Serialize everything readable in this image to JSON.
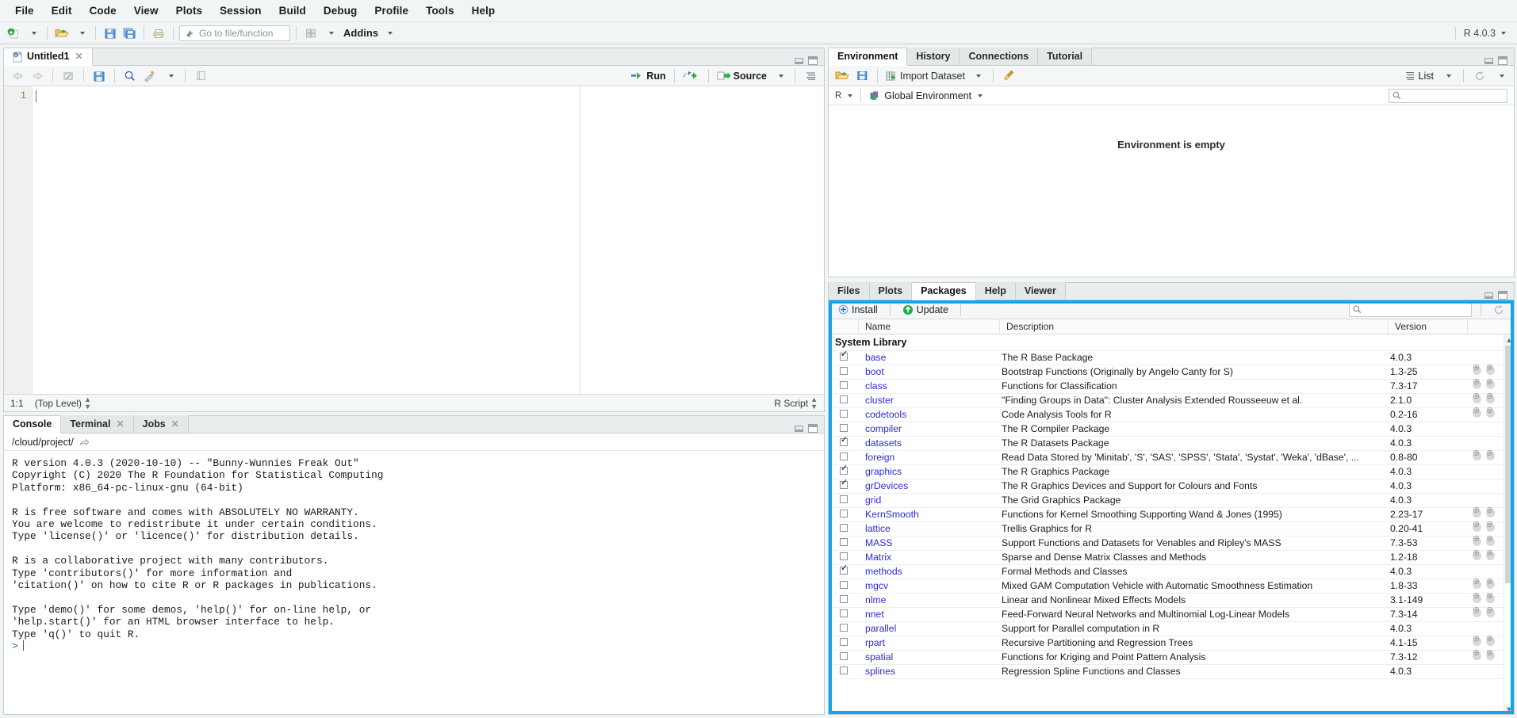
{
  "menubar": {
    "items": [
      "File",
      "Edit",
      "Code",
      "View",
      "Plots",
      "Session",
      "Build",
      "Debug",
      "Profile",
      "Tools",
      "Help"
    ]
  },
  "toolbar": {
    "new_file_icon": "new-file-icon",
    "open_file_icon": "open-folder-icon",
    "save_icon": "save-icon",
    "save_all_icon": "save-all-icon",
    "print_icon": "print-icon",
    "goto_placeholder": "Go to file/function",
    "goto_icon": "arrow-icon",
    "panes_icon": "workspace-panes-icon",
    "addins_label": "Addins",
    "r_version": "R 4.0.3"
  },
  "source": {
    "tab_label": "Untitled1",
    "tab_icon": "r-script-icon",
    "toolbar_icons": [
      "back-arrow-icon",
      "forward-arrow-icon",
      "show-in-new-window-icon",
      "save-icon",
      "find-replace-icon",
      "code-tools-icon",
      "compile-report-icon"
    ],
    "run_label": "Run",
    "source_label": "Source",
    "rerun_icon": "rerun-icon",
    "outline_icon": "document-outline-icon",
    "line_numbers": [
      "1"
    ],
    "code_lines": [
      ""
    ],
    "status_position": "1:1",
    "status_scope": "(Top Level)",
    "status_type": "R Script"
  },
  "console": {
    "tabs": [
      {
        "label": "Console",
        "closable": false,
        "active": true
      },
      {
        "label": "Terminal",
        "closable": true,
        "active": false
      },
      {
        "label": "Jobs",
        "closable": true,
        "active": false
      }
    ],
    "path": "/cloud/project/",
    "path_icon": "open-in-new-window-icon",
    "output": "R version 4.0.3 (2020-10-10) -- \"Bunny-Wunnies Freak Out\"\nCopyright (C) 2020 The R Foundation for Statistical Computing\nPlatform: x86_64-pc-linux-gnu (64-bit)\n\nR is free software and comes with ABSOLUTELY NO WARRANTY.\nYou are welcome to redistribute it under certain conditions.\nType 'license()' or 'licence()' for distribution details.\n\nR is a collaborative project with many contributors.\nType 'contributors()' for more information and\n'citation()' on how to cite R or R packages in publications.\n\nType 'demo()' for some demos, 'help()' for on-line help, or\n'help.start()' for an HTML browser interface to help.\nType 'q()' to quit R.\n",
    "prompt": ">"
  },
  "environment": {
    "tabs": [
      {
        "label": "Environment",
        "active": true
      },
      {
        "label": "History",
        "active": false
      },
      {
        "label": "Connections",
        "active": false
      },
      {
        "label": "Tutorial",
        "active": false
      }
    ],
    "toolbar": {
      "load_icon": "load-workspace-icon",
      "save_icon": "save-workspace-icon",
      "import_label": "Import Dataset",
      "broom_icon": "clear-objects-icon",
      "list_label": "List",
      "list_icon": "list-view-icon",
      "refresh_icon": "refresh-icon"
    },
    "language_selector": "R",
    "scope_label": "Global Environment",
    "scope_icon": "cube-icon",
    "search_placeholder": "",
    "search_icon": "search-icon",
    "empty_message": "Environment is empty"
  },
  "packages": {
    "tabs": [
      {
        "label": "Files",
        "active": false
      },
      {
        "label": "Plots",
        "active": false
      },
      {
        "label": "Packages",
        "active": true
      },
      {
        "label": "Help",
        "active": false
      },
      {
        "label": "Viewer",
        "active": false
      }
    ],
    "toolbar": {
      "install_label": "Install",
      "install_icon": "install-package-icon",
      "update_label": "Update",
      "update_icon": "update-package-icon",
      "search_placeholder": "",
      "search_icon": "search-icon",
      "refresh_icon": "refresh-icon"
    },
    "columns": [
      "",
      "Name",
      "Description",
      "Version",
      ""
    ],
    "groups": [
      {
        "title": "System Library",
        "rows": [
          {
            "checked": true,
            "name": "base",
            "description": "The R Base Package",
            "version": "4.0.3",
            "actions": false
          },
          {
            "checked": false,
            "name": "boot",
            "description": "Bootstrap Functions (Originally by Angelo Canty for S)",
            "version": "1.3-25",
            "actions": true
          },
          {
            "checked": false,
            "name": "class",
            "description": "Functions for Classification",
            "version": "7.3-17",
            "actions": true
          },
          {
            "checked": false,
            "name": "cluster",
            "description": "\"Finding Groups in Data\": Cluster Analysis Extended Rousseeuw et al.",
            "version": "2.1.0",
            "actions": true
          },
          {
            "checked": false,
            "name": "codetools",
            "description": "Code Analysis Tools for R",
            "version": "0.2-16",
            "actions": true
          },
          {
            "checked": false,
            "name": "compiler",
            "description": "The R Compiler Package",
            "version": "4.0.3",
            "actions": false
          },
          {
            "checked": true,
            "name": "datasets",
            "description": "The R Datasets Package",
            "version": "4.0.3",
            "actions": false
          },
          {
            "checked": false,
            "name": "foreign",
            "description": "Read Data Stored by 'Minitab', 'S', 'SAS', 'SPSS', 'Stata', 'Systat', 'Weka', 'dBase', ...",
            "version": "0.8-80",
            "actions": true
          },
          {
            "checked": true,
            "name": "graphics",
            "description": "The R Graphics Package",
            "version": "4.0.3",
            "actions": false
          },
          {
            "checked": true,
            "name": "grDevices",
            "description": "The R Graphics Devices and Support for Colours and Fonts",
            "version": "4.0.3",
            "actions": false
          },
          {
            "checked": false,
            "name": "grid",
            "description": "The Grid Graphics Package",
            "version": "4.0.3",
            "actions": false
          },
          {
            "checked": false,
            "name": "KernSmooth",
            "description": "Functions for Kernel Smoothing Supporting Wand & Jones (1995)",
            "version": "2.23-17",
            "actions": true
          },
          {
            "checked": false,
            "name": "lattice",
            "description": "Trellis Graphics for R",
            "version": "0.20-41",
            "actions": true
          },
          {
            "checked": false,
            "name": "MASS",
            "description": "Support Functions and Datasets for Venables and Ripley's MASS",
            "version": "7.3-53",
            "actions": true
          },
          {
            "checked": false,
            "name": "Matrix",
            "description": "Sparse and Dense Matrix Classes and Methods",
            "version": "1.2-18",
            "actions": true
          },
          {
            "checked": true,
            "name": "methods",
            "description": "Formal Methods and Classes",
            "version": "4.0.3",
            "actions": false
          },
          {
            "checked": false,
            "name": "mgcv",
            "description": "Mixed GAM Computation Vehicle with Automatic Smoothness Estimation",
            "version": "1.8-33",
            "actions": true
          },
          {
            "checked": false,
            "name": "nlme",
            "description": "Linear and Nonlinear Mixed Effects Models",
            "version": "3.1-149",
            "actions": true
          },
          {
            "checked": false,
            "name": "nnet",
            "description": "Feed-Forward Neural Networks and Multinomial Log-Linear Models",
            "version": "7.3-14",
            "actions": true
          },
          {
            "checked": false,
            "name": "parallel",
            "description": "Support for Parallel computation in R",
            "version": "4.0.3",
            "actions": false
          },
          {
            "checked": false,
            "name": "rpart",
            "description": "Recursive Partitioning and Regression Trees",
            "version": "4.1-15",
            "actions": true
          },
          {
            "checked": false,
            "name": "spatial",
            "description": "Functions for Kriging and Point Pattern Analysis",
            "version": "7.3-12",
            "actions": true
          },
          {
            "checked": false,
            "name": "splines",
            "description": "Regression Spline Functions and Classes",
            "version": "4.0.3",
            "actions": false
          }
        ]
      }
    ]
  },
  "colors": {
    "highlight": "#12a5ec",
    "link": "#2b2bd6",
    "chrome": "#f2f5f6"
  }
}
